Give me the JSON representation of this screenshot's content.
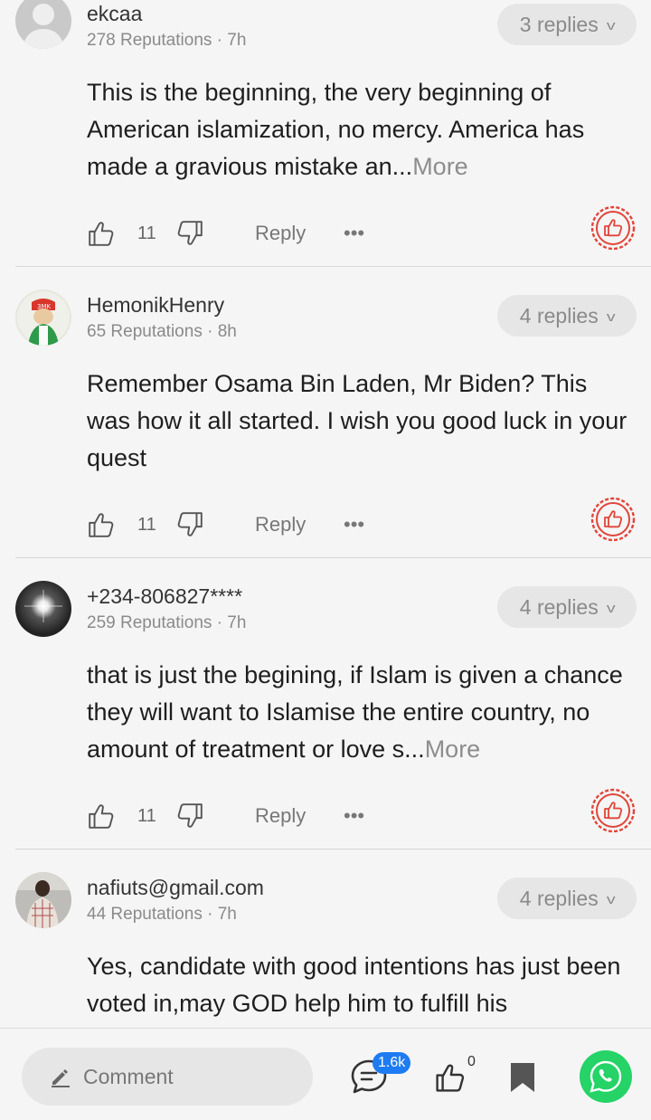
{
  "comments": [
    {
      "username": "ekcaa",
      "reputation": "278 Reputations",
      "time": "7h",
      "replies": "3 replies",
      "text": "This is the beginning, the very beginning of American islamization, no mercy. America has made a gravious mistake an...",
      "more": "More",
      "likes": "11",
      "reply_label": "Reply",
      "avatar_icon": "default-avatar-icon"
    },
    {
      "username": "HemonikHenry",
      "reputation": "65 Reputations",
      "time": "8h",
      "replies": "4 replies",
      "text": "Remember Osama Bin Laden, Mr Biden? This was how it all started. I wish you good luck in your quest",
      "more": "",
      "likes": "11",
      "reply_label": "Reply",
      "avatar_icon": "cartoon-avatar-icon"
    },
    {
      "username": "+234-806827****",
      "reputation": "259 Reputations",
      "time": "7h",
      "replies": "4 replies",
      "text": "that is just the begining, if Islam is given a chance they will want to Islamise the entire country, no amount of treatment or love s...",
      "more": "More",
      "likes": "11",
      "reply_label": "Reply",
      "avatar_icon": "light-flare-avatar-icon"
    },
    {
      "username": "nafiuts@gmail.com",
      "reputation": "44 Reputations",
      "time": "7h",
      "replies": "4 replies",
      "text": "Yes, candidate with good intentions has just been voted in,may GOD help him to fulfill his",
      "more": "",
      "likes": "",
      "reply_label": "",
      "avatar_icon": "photo-avatar-icon"
    }
  ],
  "bottom_bar": {
    "comment_placeholder": "Comment",
    "comments_count": "1.6k",
    "likes_count": "0"
  },
  "colors": {
    "accent_red": "#e0453a",
    "badge_blue": "#1e7cf2",
    "whatsapp_green": "#25d366",
    "background": "#f5f5f5"
  }
}
